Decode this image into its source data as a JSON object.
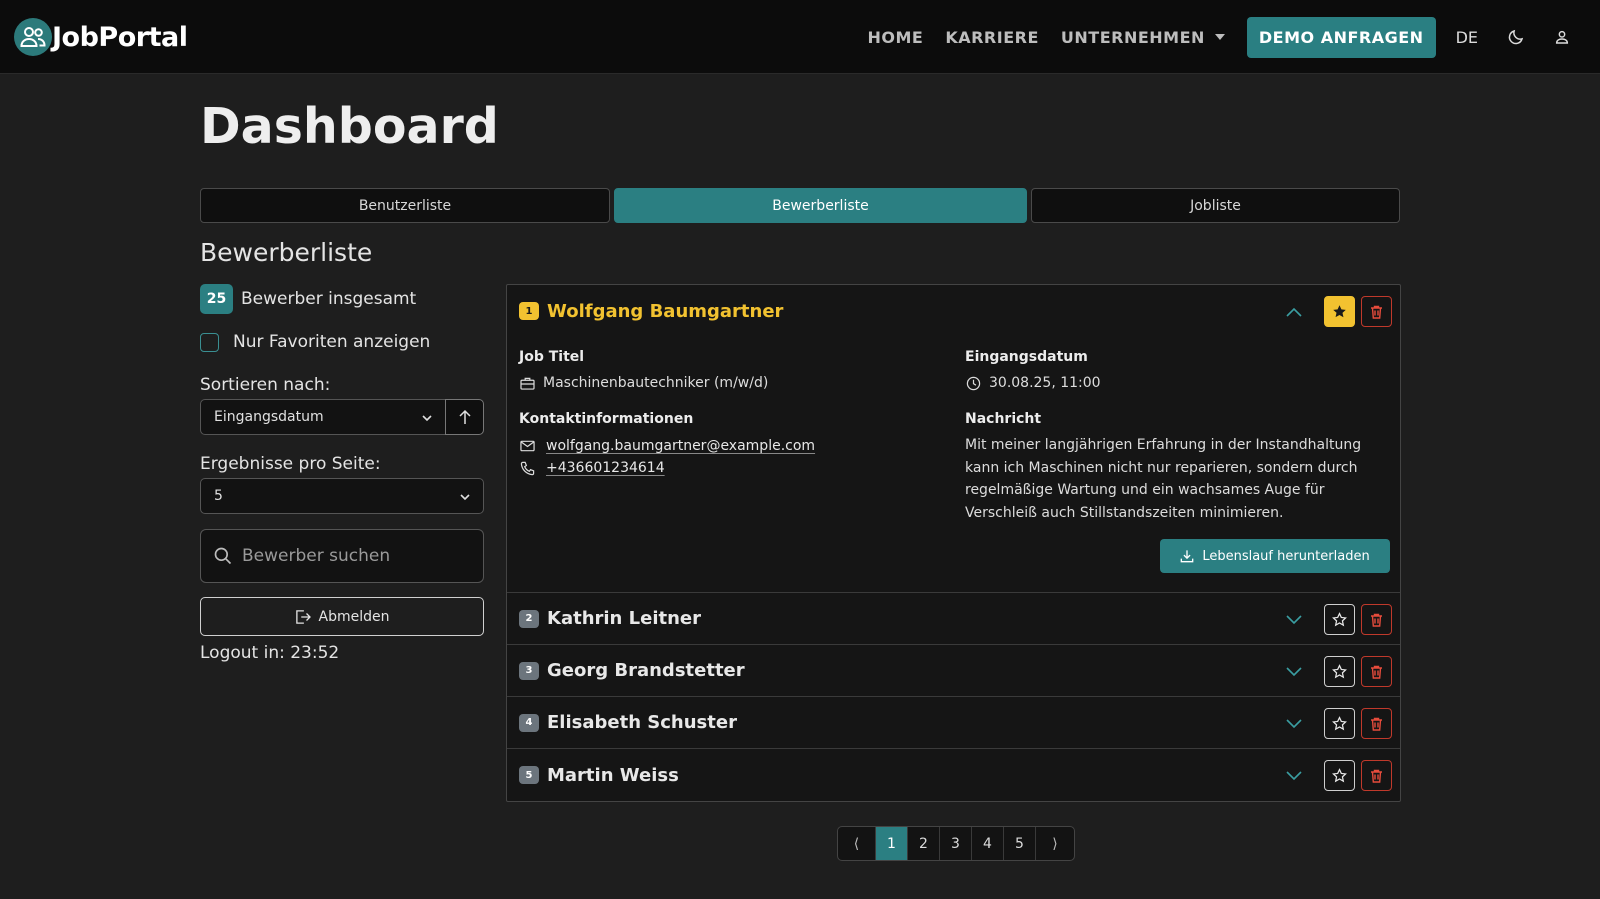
{
  "nav": {
    "brand": "JobPortal",
    "links": [
      "HOME",
      "KARRIERE",
      "UNTERNEHMEN"
    ],
    "demo_label": "DEMO ANFRAGEN",
    "lang": "DE",
    "accent": "#2b7f82"
  },
  "page_title": "Dashboard",
  "tabs": [
    "Benutzerliste",
    "Bewerberliste",
    "Jobliste"
  ],
  "active_tab": "Bewerberliste",
  "section_title": "Bewerberliste",
  "sidebar": {
    "count": "25",
    "count_label": "Bewerber insgesamt",
    "favorites_label": "Nur Favoriten anzeigen",
    "favorites_checked": false,
    "sort_label": "Sortieren nach:",
    "sort_value": "Eingangsdatum",
    "per_page_label": "Ergebnisse pro Seite:",
    "per_page_value": "5",
    "search_placeholder": "Bewerber suchen",
    "logout_label": "Abmelden",
    "logout_timer": "Logout in: 23:52"
  },
  "applicants": [
    {
      "num": "1",
      "name": "Wolfgang Baumgartner",
      "favorite": true,
      "expanded": true,
      "job_title_label": "Job Titel",
      "job_title": "Maschinenbautechniker (m/w/d)",
      "date_label": "Eingangsdatum",
      "date": "30.08.25, 11:00",
      "contact_label": "Kontaktinformationen",
      "email": "wolfgang.baumgartner@example.com",
      "phone": "+436601234614",
      "message_label": "Nachricht",
      "message": "Mit meiner langjährigen Erfahrung in der Instandhaltung kann ich Maschinen nicht nur reparieren, sondern durch regelmäßige Wartung und ein wachsames Auge für Verschleiß auch Stillstandszeiten minimieren.",
      "download_label": "Lebenslauf herunterladen"
    },
    {
      "num": "2",
      "name": "Kathrin Leitner",
      "favorite": false,
      "expanded": false
    },
    {
      "num": "3",
      "name": "Georg Brandstetter",
      "favorite": false,
      "expanded": false
    },
    {
      "num": "4",
      "name": "Elisabeth Schuster",
      "favorite": false,
      "expanded": false
    },
    {
      "num": "5",
      "name": "Martin Weiss",
      "favorite": false,
      "expanded": false
    }
  ],
  "pagination": {
    "prev": "⟨",
    "pages": [
      "1",
      "2",
      "3",
      "4",
      "5"
    ],
    "current": "1",
    "next": "⟩"
  }
}
